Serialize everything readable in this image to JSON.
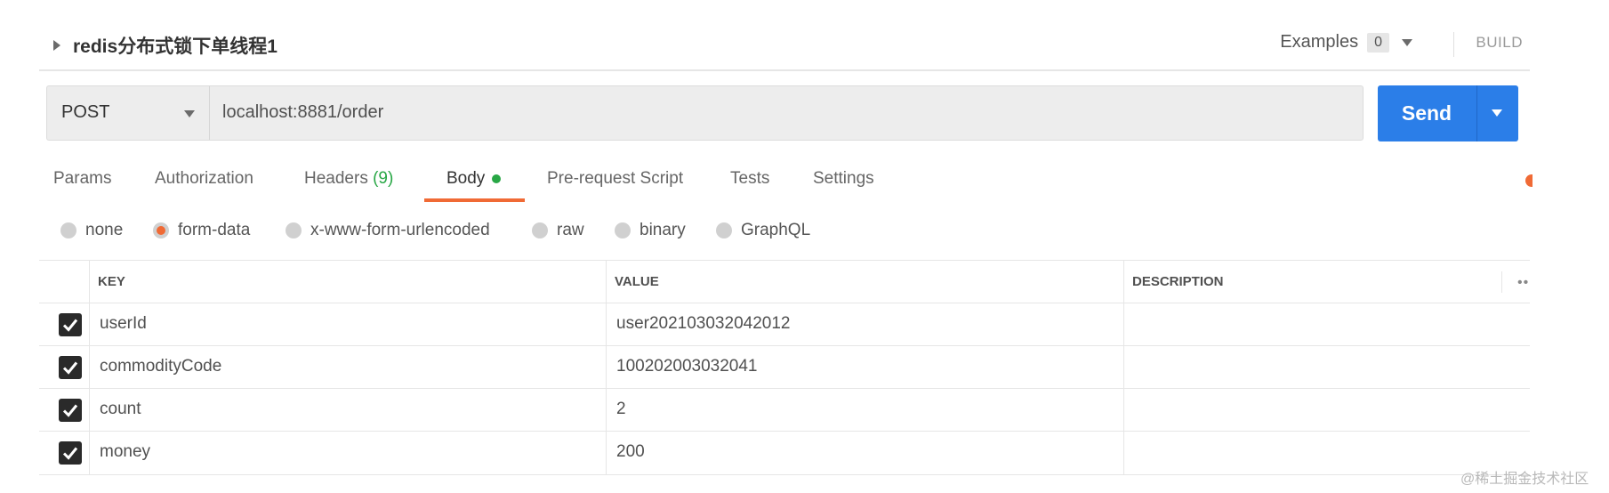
{
  "request": {
    "name": "redis分布式锁下单线程1",
    "examples_label": "Examples",
    "examples_count": "0",
    "build_label": "BUILD",
    "method": "POST",
    "url": "localhost:8881/order",
    "send_label": "Send"
  },
  "tabs": [
    {
      "label": "Params"
    },
    {
      "label": "Authorization"
    },
    {
      "label": "Headers",
      "badge": "(9)"
    },
    {
      "label": "Body",
      "active": true
    },
    {
      "label": "Pre-request Script"
    },
    {
      "label": "Tests"
    },
    {
      "label": "Settings"
    }
  ],
  "body_types": [
    {
      "label": "none"
    },
    {
      "label": "form-data",
      "selected": true
    },
    {
      "label": "x-www-form-urlencoded"
    },
    {
      "label": "raw"
    },
    {
      "label": "binary"
    },
    {
      "label": "GraphQL"
    }
  ],
  "table": {
    "headers": {
      "key": "KEY",
      "value": "VALUE",
      "description": "DESCRIPTION",
      "more": "••"
    },
    "rows": [
      {
        "checked": true,
        "key": "userId",
        "value": "user202103032042012",
        "description": ""
      },
      {
        "checked": true,
        "key": "commodityCode",
        "value": "100202003032041",
        "description": ""
      },
      {
        "checked": true,
        "key": "count",
        "value": "2",
        "description": ""
      },
      {
        "checked": true,
        "key": "money",
        "value": "200",
        "description": ""
      }
    ]
  },
  "watermark": "@稀土掘金技术社区",
  "colors": {
    "accent": "#f06a35",
    "send": "#2b7ee8",
    "green": "#28a745"
  }
}
